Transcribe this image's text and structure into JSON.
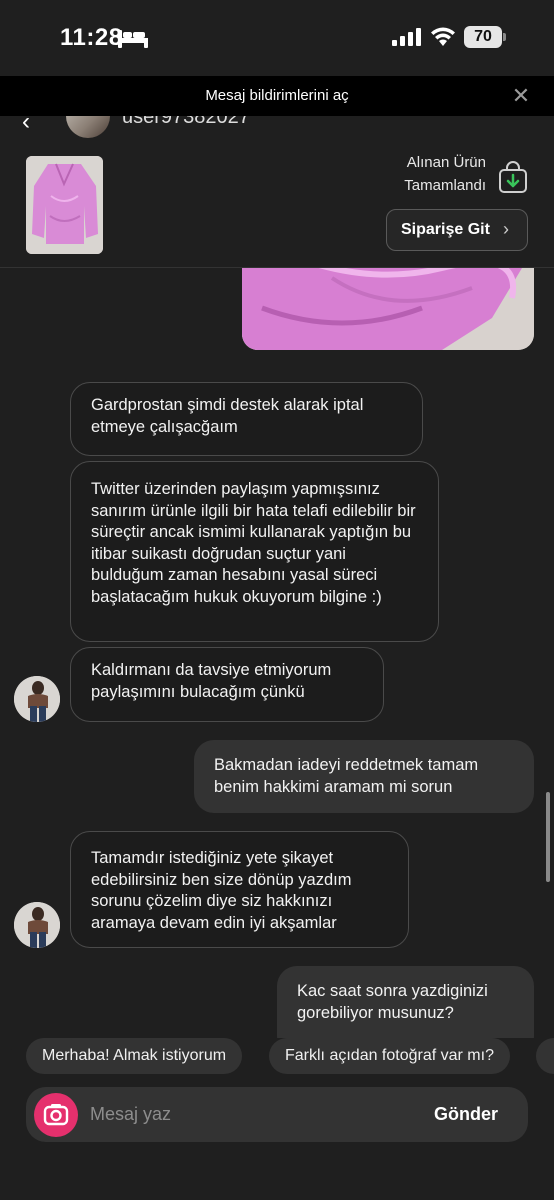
{
  "status_bar": {
    "time": "11:28",
    "battery": "70",
    "icons": [
      "bed-icon",
      "signal-icon",
      "wifi-icon",
      "battery-icon"
    ]
  },
  "notification": {
    "text": "Mesaj bildirimlerini aç",
    "close_icon": "close-icon"
  },
  "header": {
    "username": "user97382027"
  },
  "product": {
    "status_line1": "Alınan Ürün",
    "status_line2": "Tamamlandı",
    "order_button": "Siparişe Git",
    "order_chevron": "›"
  },
  "messages": [
    {
      "side": "in",
      "text": "Gardprostan şimdi destek alarak iptal etmeye çalışacğaım"
    },
    {
      "side": "in",
      "text": "Twitter üzerinden paylaşım yapmışsınız sanırım ürünle ilgili bir hata telafi edilebilir bir süreçtir ancak ismimi kullanarak yaptığın bu itibar suikastı doğrudan suçtur yani bulduğum zaman hesabını yasal süreci başlatacağım hukuk okuyorum bilgine :)"
    },
    {
      "side": "in",
      "text": "Kaldırmanı da tavsiye etmiyorum paylaşımını bulacağım çünkü"
    },
    {
      "side": "out",
      "text": "Bakmadan iadeyi reddetmek tamam benim hakkimi aramam mi sorun"
    },
    {
      "side": "in",
      "text": "Tamamdır istediğiniz yete şikayet edebilirsiniz ben size dönüp yazdım sorunu çözelim diye siz hakkınızı aramaya devam edin iyi akşamlar"
    },
    {
      "side": "out",
      "text": "Kac saat sonra yazdiginizi gorebiliyor musunuz?"
    }
  ],
  "quick_replies": [
    "Merhaba! Almak istiyorum",
    "Farklı açıdan fotoğraf var mı?",
    ""
  ],
  "input": {
    "placeholder": "Mesaj yaz",
    "send_label": "Gönder"
  }
}
